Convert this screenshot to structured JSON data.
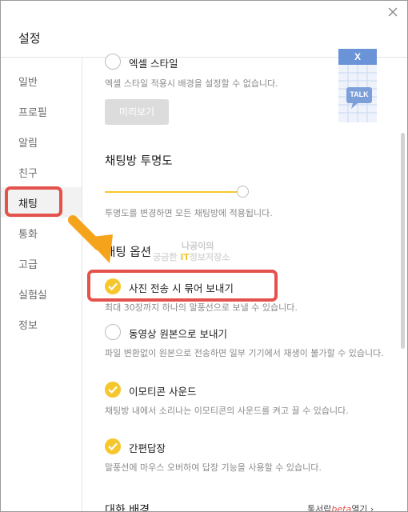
{
  "window": {
    "title": "설정"
  },
  "sidebar": {
    "items": [
      {
        "label": "일반"
      },
      {
        "label": "프로필"
      },
      {
        "label": "알림"
      },
      {
        "label": "친구"
      },
      {
        "label": "채팅"
      },
      {
        "label": "통화"
      },
      {
        "label": "고급"
      },
      {
        "label": "실험실"
      },
      {
        "label": "정보"
      }
    ],
    "active_index": 4
  },
  "excel_style": {
    "label": "엑셀 스타일",
    "checked": false,
    "description": "엑셀 스타일 적용시 배경을 설정할 수 없습니다.",
    "preview_button": "미리보기",
    "thumbnail_text": "TALK",
    "thumbnail_mark": "X"
  },
  "transparency": {
    "title": "채팅방 투명도",
    "value_fraction": 1.0,
    "description": "투명도를 변경하면 모든 채팅방에 적용됩니다."
  },
  "chat_options": {
    "title": "채팅 옵션",
    "options": [
      {
        "label": "사진 전송 시 묶어 보내기",
        "checked": true,
        "description": "최대 30장까지 하나의 말풍선으로 보낼 수 있습니다."
      },
      {
        "label": "동영상 원본으로 보내기",
        "checked": false,
        "description": "파일 변환없이 원본으로 전송하면 일부 기기에서 재생이 불가할 수 있습니다."
      },
      {
        "label": "이모티콘 사운드",
        "checked": true,
        "description": "채팅방 내에서 소리나는 이모티콘의 사운드를 켜고 끌 수 있습니다."
      },
      {
        "label": "간편답장",
        "checked": true,
        "description": "말풍선에 마우스 오버하여 답장 기능을 사용할 수 있습니다."
      }
    ]
  },
  "chat_background": {
    "title": "대화 배경",
    "link_prefix": "통서랍",
    "link_beta": "beta",
    "link_suffix": "열기"
  },
  "watermark": {
    "line1": "나공이의",
    "line2_a": "궁금한 ",
    "line2_b": "IT",
    "line2_c": "정보저장소"
  },
  "colors": {
    "accent_yellow": "#f6c72d",
    "highlight_red": "#e5514b",
    "annotation_arrow": "#f5a31a"
  }
}
